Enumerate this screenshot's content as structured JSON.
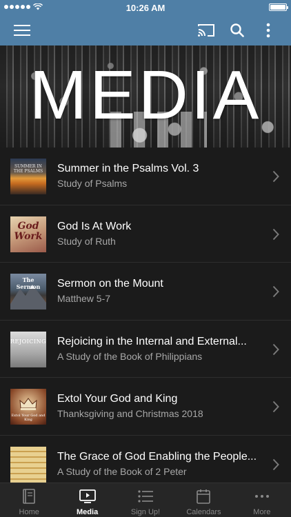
{
  "status_bar": {
    "time": "10:26 AM"
  },
  "nav_bar": {
    "menu_icon": "hamburger-menu-icon",
    "cast_icon": "cast-icon",
    "search_icon": "search-icon",
    "more_icon": "vertical-dots-icon"
  },
  "banner": {
    "title": "MEDIA"
  },
  "media_items": [
    {
      "title": "Summer in the Psalms Vol. 3",
      "subtitle": "Study of Psalms",
      "thumb_text": "SUMMER IN THE PSALMS"
    },
    {
      "title": "God Is At Work",
      "subtitle": "Study of Ruth",
      "thumb_text": "God Work"
    },
    {
      "title": "Sermon on the Mount",
      "subtitle": "Matthew 5-7",
      "thumb_text": "The Sermon"
    },
    {
      "title": "Rejoicing in the Internal and External...",
      "subtitle": "A Study of the Book of Philippians",
      "thumb_text": "REJOICING"
    },
    {
      "title": "Extol Your God and King",
      "subtitle": "Thanksgiving and Christmas 2018",
      "thumb_text": "Extol Your God and King"
    },
    {
      "title": "The Grace of God Enabling the People...",
      "subtitle": "A Study of the Book of 2 Peter",
      "thumb_text": ""
    }
  ],
  "tab_bar": {
    "tabs": [
      {
        "label": "Home",
        "icon": "book-icon"
      },
      {
        "label": "Media",
        "icon": "media-play-icon"
      },
      {
        "label": "Sign Up!",
        "icon": "list-icon"
      },
      {
        "label": "Calendars",
        "icon": "calendar-icon"
      },
      {
        "label": "More",
        "icon": "more-dots-icon"
      }
    ],
    "active": "Media"
  },
  "colors": {
    "accent": "#4f7fa6",
    "background": "#1b1b1b",
    "tab_bar": "#262626"
  }
}
